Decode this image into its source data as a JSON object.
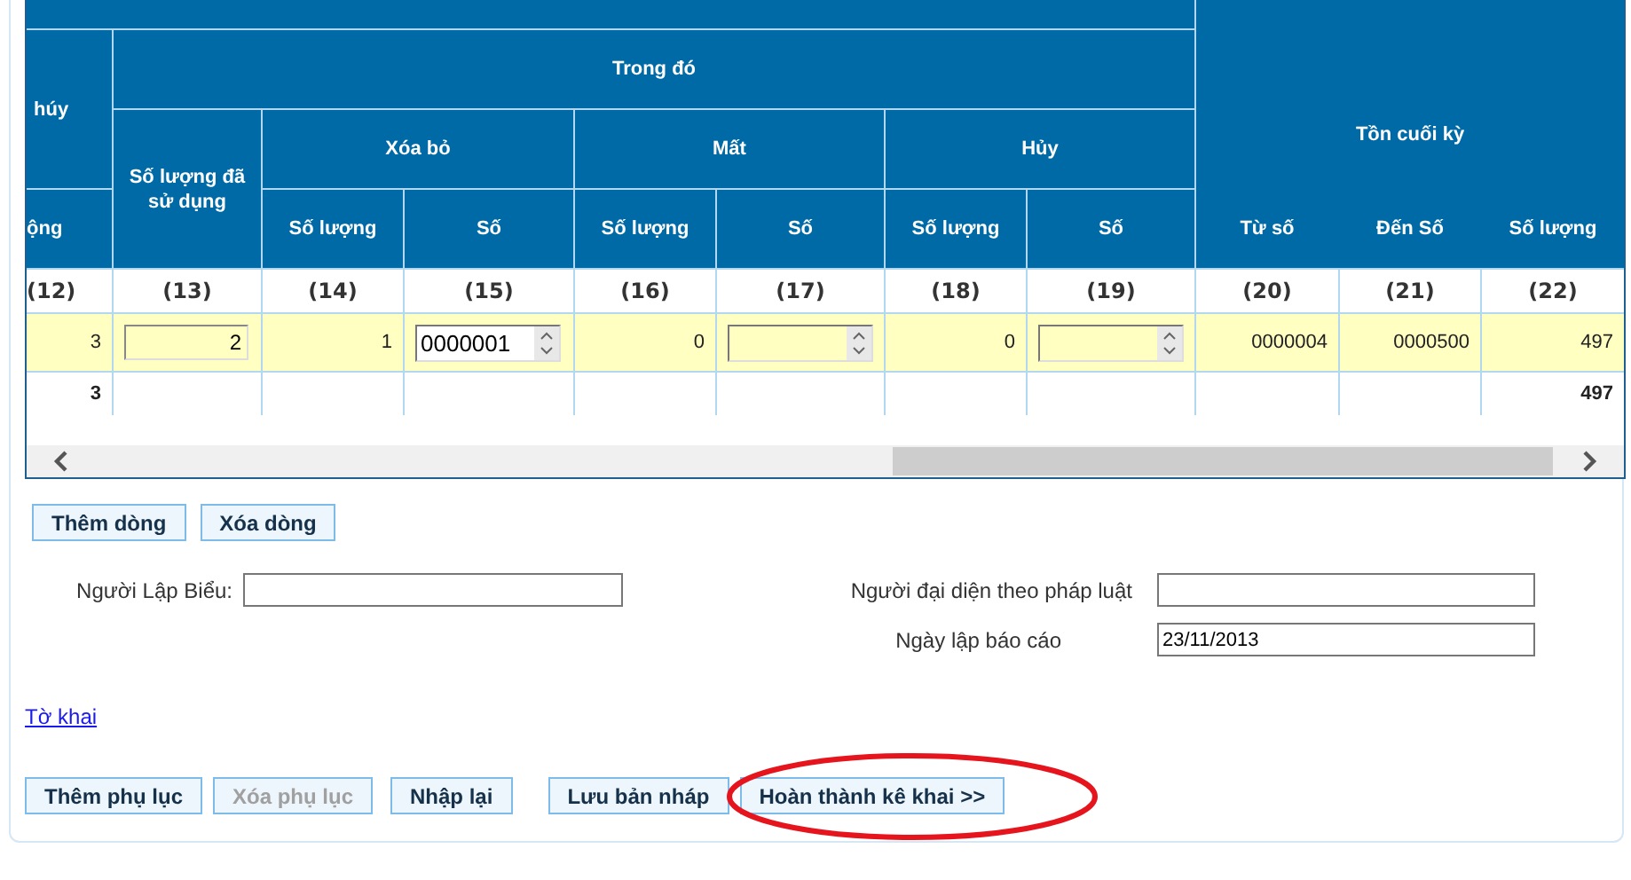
{
  "table": {
    "header": {
      "column_12_group": "húy",
      "group_main": "Trong đó",
      "used": "Số lượng đã sử dụng",
      "groups": [
        "Xóa bỏ",
        "Mất",
        "Hủy"
      ],
      "closing": "Tồn cuối kỳ",
      "subheaders": [
        "ộng",
        "Số lượng",
        "Số",
        "Số lượng",
        "Số",
        "Số lượng",
        "Số",
        "Từ số",
        "Đến Số",
        "Số lượng"
      ]
    },
    "column_numbers": [
      "(12)",
      "(13)",
      "(14)",
      "(15)",
      "(16)",
      "(17)",
      "(18)",
      "(19)",
      "(20)",
      "(21)",
      "(22)"
    ],
    "rows": [
      {
        "selected": true,
        "cells": [
          {
            "kind": "text",
            "value": "3"
          },
          {
            "kind": "input",
            "value": "2"
          },
          {
            "kind": "text",
            "value": "1"
          },
          {
            "kind": "spinner",
            "value": "0000001"
          },
          {
            "kind": "text",
            "value": "0"
          },
          {
            "kind": "spinner"
          },
          {
            "kind": "text",
            "value": "0"
          },
          {
            "kind": "spinner"
          },
          {
            "kind": "text",
            "value": "0000004"
          },
          {
            "kind": "text",
            "value": "0000500"
          },
          {
            "kind": "text",
            "value": "497"
          }
        ]
      }
    ],
    "total_row": {
      "column_12": "3",
      "column_22": "497"
    }
  },
  "row_buttons": [
    {
      "label": "Thêm dòng",
      "disabled": false
    },
    {
      "label": "Xóa dòng",
      "disabled": false
    }
  ],
  "form": {
    "preparer": {
      "label": "Người Lập Biểu:"
    },
    "legal_representative": {
      "label": "Người đại diện theo pháp luật"
    },
    "report_date": {
      "label": "Ngày lập báo cáo",
      "value": "23/11/2013"
    }
  },
  "link": "Tờ khai",
  "action_buttons": [
    {
      "label": "Thêm phụ lục",
      "disabled": false,
      "circled": false
    },
    {
      "label": "Xóa phụ lục",
      "disabled": true,
      "circled": false
    },
    {
      "label": "Nhập lại",
      "disabled": false,
      "circled": false
    },
    {
      "label": "Lưu bản nháp",
      "disabled": false,
      "circled": false
    },
    {
      "label": "Hoàn thành kê khai >>",
      "disabled": false,
      "circled": true
    }
  ]
}
